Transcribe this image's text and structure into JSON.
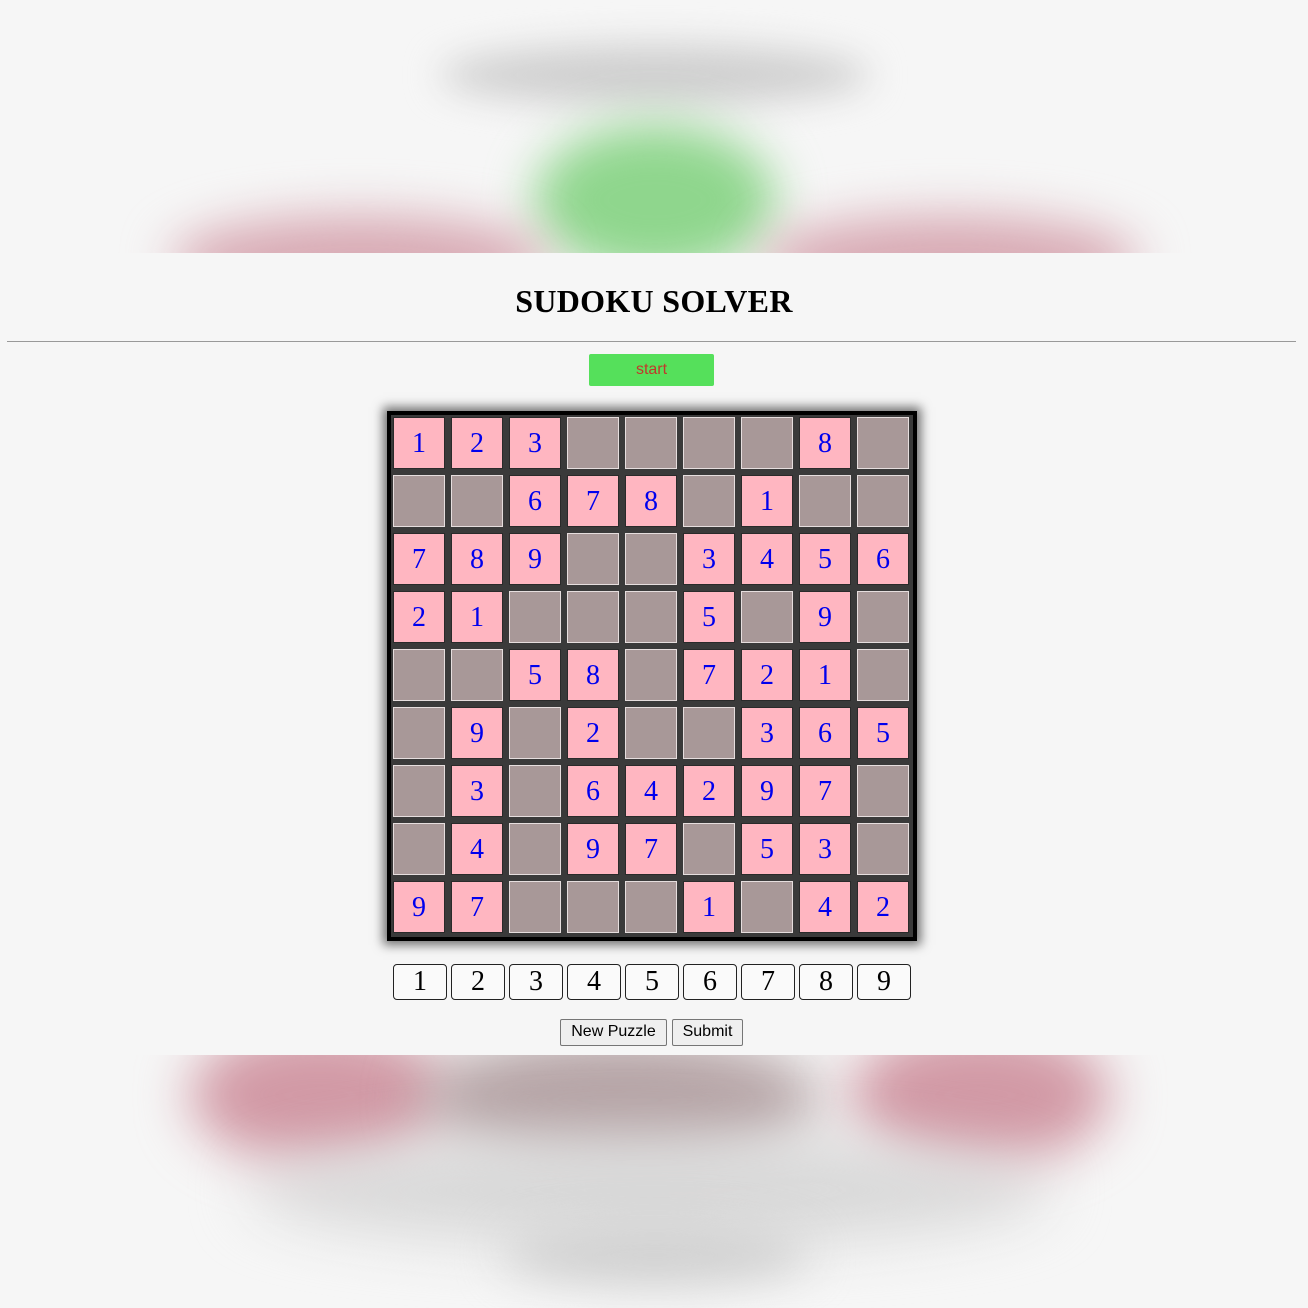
{
  "title": "SUDOKU SOLVER",
  "start_label": "start",
  "board": [
    [
      1,
      2,
      3,
      0,
      0,
      0,
      0,
      8,
      0
    ],
    [
      0,
      0,
      6,
      7,
      8,
      0,
      1,
      0,
      0
    ],
    [
      7,
      8,
      9,
      0,
      0,
      3,
      4,
      5,
      6
    ],
    [
      2,
      1,
      0,
      0,
      0,
      5,
      0,
      9,
      0
    ],
    [
      0,
      0,
      5,
      8,
      0,
      7,
      2,
      1,
      0
    ],
    [
      0,
      9,
      0,
      2,
      0,
      0,
      3,
      6,
      5
    ],
    [
      0,
      3,
      0,
      6,
      4,
      2,
      9,
      7,
      0
    ],
    [
      0,
      4,
      0,
      9,
      7,
      0,
      5,
      3,
      0
    ],
    [
      9,
      7,
      0,
      0,
      0,
      1,
      0,
      4,
      2
    ]
  ],
  "digit_buttons": [
    "1",
    "2",
    "3",
    "4",
    "5",
    "6",
    "7",
    "8",
    "9"
  ],
  "actions": {
    "new_puzzle": "New Puzzle",
    "submit": "Submit"
  },
  "colors": {
    "filled_cell": "#ffb6c1",
    "empty_cell": "#a89898",
    "digit_text": "#0000ee",
    "start_button": "#55e05b",
    "start_text": "#c0392b"
  }
}
